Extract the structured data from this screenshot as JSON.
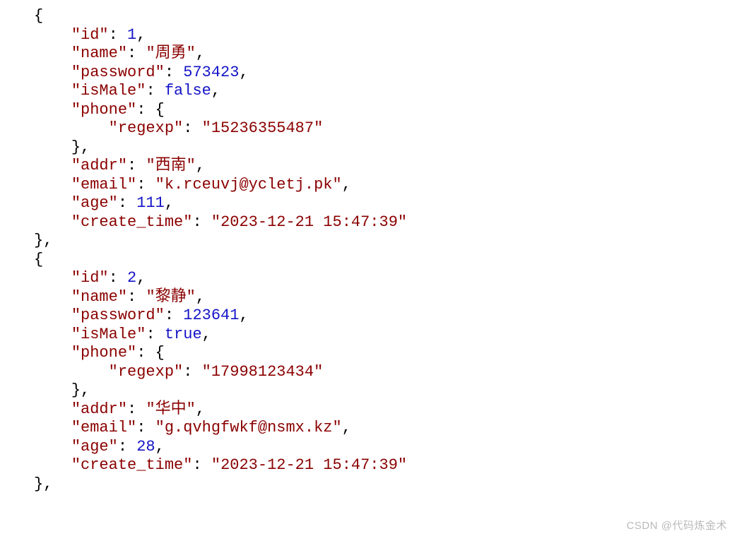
{
  "watermark": "CSDN @代码炼金术",
  "records": [
    {
      "id": 1,
      "name": "周勇",
      "password": 573423,
      "isMale": false,
      "phone": {
        "regexp": "15236355487"
      },
      "addr": "西南",
      "email": "k.rceuvj@ycletj.pk",
      "age": 111,
      "create_time": "2023-12-21 15:47:39"
    },
    {
      "id": 2,
      "name": "黎静",
      "password": 123641,
      "isMale": true,
      "phone": {
        "regexp": "17998123434"
      },
      "addr": "华中",
      "email": "g.qvhgfwkf@nsmx.kz",
      "age": 28,
      "create_time": "2023-12-21 15:47:39"
    }
  ]
}
